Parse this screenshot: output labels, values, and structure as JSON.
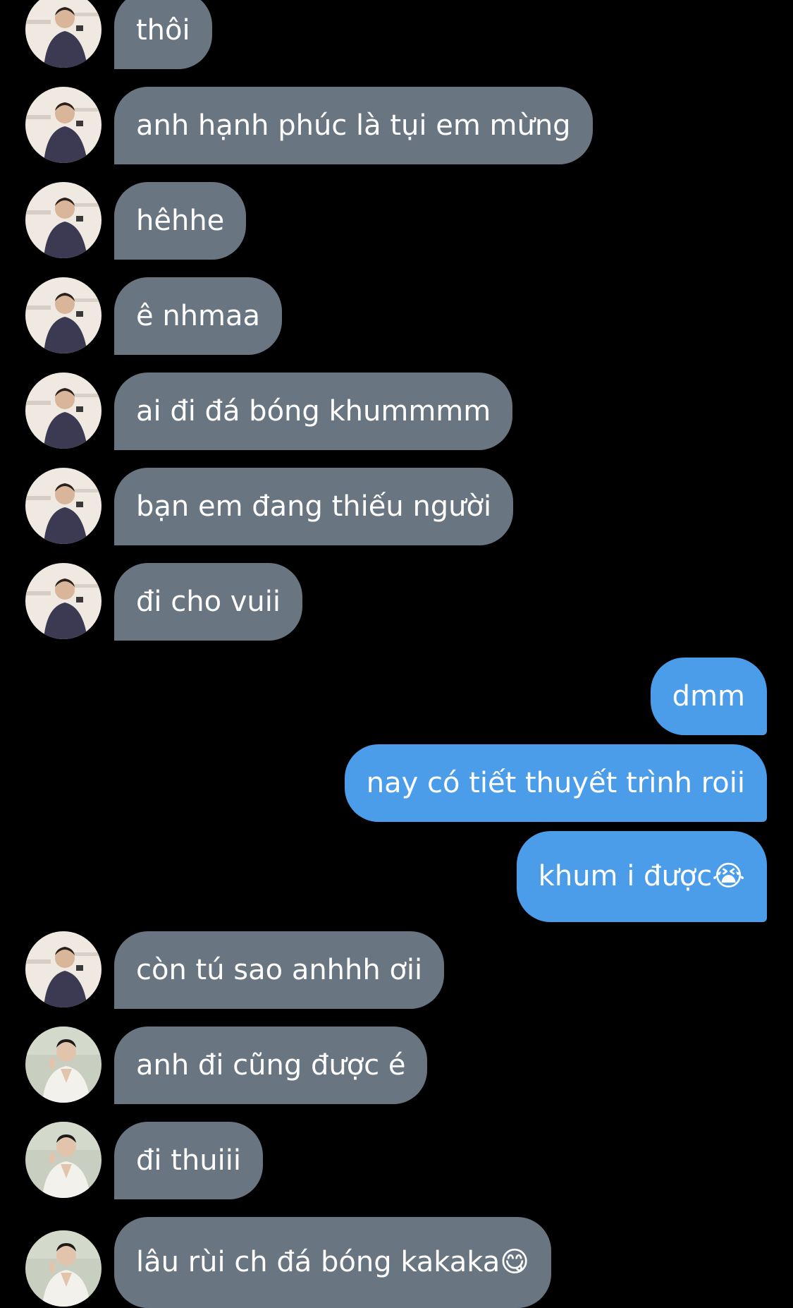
{
  "messages": [
    {
      "side": "in",
      "text": "thôi",
      "avatar": "person-a-avatar"
    },
    {
      "side": "in",
      "text": "anh hạnh phúc là tụi em mừng",
      "avatar": "person-a-avatar"
    },
    {
      "side": "in",
      "text": "hêhhe",
      "avatar": "person-a-avatar"
    },
    {
      "side": "in",
      "text": "ê nhmaa",
      "avatar": "person-a-avatar"
    },
    {
      "side": "in",
      "text": "ai đi đá bóng khummmm",
      "avatar": "person-a-avatar"
    },
    {
      "side": "in",
      "text": "bạn em đang thiếu người",
      "avatar": "person-a-avatar"
    },
    {
      "side": "in",
      "text": "đi cho vuii",
      "avatar": "person-a-avatar"
    },
    {
      "side": "out",
      "text": "dmm"
    },
    {
      "side": "out",
      "text": "nay có tiết thuyết trình roii"
    },
    {
      "side": "out",
      "text": "khum i được😭"
    },
    {
      "side": "in",
      "text": "còn tú sao anhhh ơii",
      "avatar": "person-a-avatar"
    },
    {
      "side": "in",
      "text": "anh đi cũng được é",
      "avatar": "person-b-avatar"
    },
    {
      "side": "in",
      "text": "đi thuiii",
      "avatar": "person-b-avatar"
    },
    {
      "side": "in",
      "text": "lâu rùi ch đá bóng kakaka😋",
      "avatar": "person-b-avatar"
    }
  ],
  "colors": {
    "background": "#000000",
    "incoming_bubble": "#6a7582",
    "outgoing_bubble": "#4c9de9",
    "text": "#ffffff"
  }
}
